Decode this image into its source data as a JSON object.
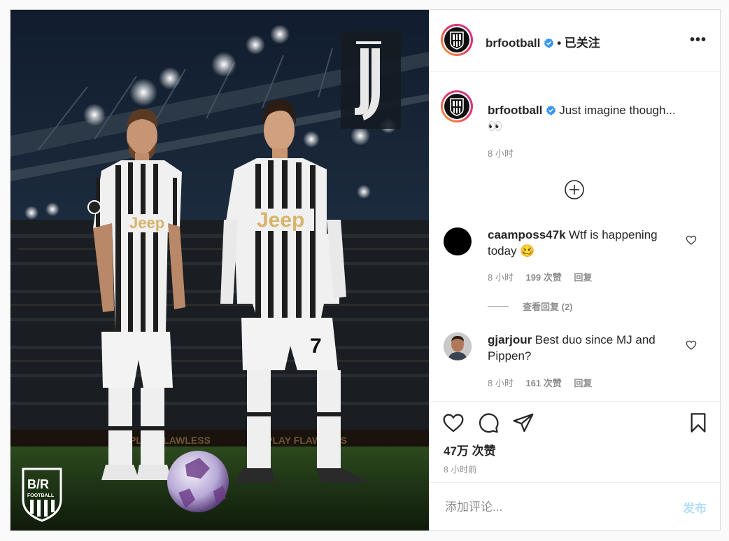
{
  "post": {
    "media": {
      "description_icon": "football-photo",
      "jersey_text": "Jeep",
      "shirt_number": "7",
      "banner_text": "PLAY FLAWLESS",
      "logo_text": "B/R",
      "logo_subtext": "FOOTBALL"
    },
    "header": {
      "username": "brfootball",
      "verified_icon": "verified-badge-icon",
      "separator": "•",
      "follow_state": "已关注",
      "more_icon": "more-options-icon"
    },
    "caption": {
      "username": "brfootball",
      "text": "Just imagine though...",
      "emoji": "👀",
      "time": "8 小时",
      "load_more_icon": "plus-circle-icon"
    },
    "comments": [
      {
        "username": "caamposs47k",
        "text_line1": "Wtf is happening",
        "text_line2": "today 🥴",
        "time": "8 小时",
        "likes": "199 次赞",
        "reply": "回复",
        "view_replies": "查看回复 (2)"
      },
      {
        "username": "gjarjour",
        "text_line1": "Best duo since MJ and",
        "text_line2": "Pippen?",
        "time": "8 小时",
        "likes": "161 次赞",
        "reply": "回复"
      }
    ],
    "actions": {
      "like_icon": "heart-icon",
      "comment_icon": "comment-icon",
      "share_icon": "share-icon",
      "save_icon": "bookmark-icon",
      "likes_count": "47万 次赞",
      "posted_ago": "8 小时前"
    },
    "add_comment": {
      "placeholder": "添加评论...",
      "post_label": "发布"
    }
  },
  "colors": {
    "accent_link": "#0095f6",
    "post_button_disabled": "#b2dffc",
    "secondary_text": "#8e8e8e",
    "primary_text": "#262626",
    "border": "#dbdbdb",
    "verified": "#3897f0"
  }
}
